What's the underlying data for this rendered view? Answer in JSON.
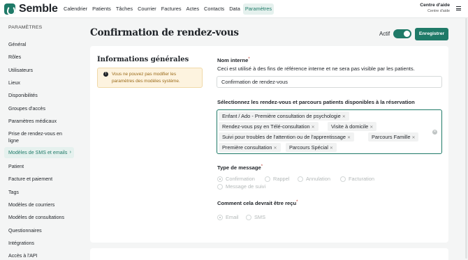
{
  "app": {
    "name": "Semble"
  },
  "nav": {
    "items": [
      "Calendrier",
      "Patients",
      "Tâches",
      "Courrier",
      "Factures",
      "Actes",
      "Contacts",
      "Data",
      "Paramètres"
    ],
    "active_index": 8
  },
  "account": {
    "name": "Centre d'aide",
    "subtitle": "Centre d'aide"
  },
  "sidebar": {
    "title": "PARAMÈTRES",
    "items": [
      "Général",
      "Rôles",
      "Utilisateurs",
      "Lieux",
      "Disponibilités",
      "Groupes d'accès",
      "Paramètres médicaux",
      "Prise de rendez-vous en ligne",
      "Modèles de SMS et emails",
      "Patient",
      "Facture et paiement",
      "Tags",
      "Modèles de courriers",
      "Modèles de consultations",
      "Questionnaires",
      "Intégrations",
      "Accès à l'API"
    ],
    "active_index": 8
  },
  "header": {
    "title": "Confirmation de rendez-vous",
    "active_label": "Actif",
    "active": true,
    "save_label": "Enregistrer"
  },
  "general": {
    "title": "Informations générales",
    "warning": "Vous ne pouvez pas modifier les paramètres des modèles système.",
    "internal_name_label": "Nom interne",
    "internal_name_help": "Ceci est utilisé à des fins de référence interne et ne sera pas visible par les patients.",
    "internal_name_value": "Confirmation de rendez-vous",
    "appointments_label": "Sélectionnez les rendez-vous et parcours patients disponibles à la réservation",
    "chips": [
      "Enfant / Ado - Première consultation de psychologie",
      "Rendez-vous psy en Télé-consultation",
      "Visite à domicile",
      "Suivi pour troubles de l'attention ou de l'apprentissage",
      "Parcours Famille",
      "Première consultation",
      "Parcours Spécial"
    ],
    "message_type_label": "Type de message",
    "message_types": [
      "Confirmation",
      "Rappel",
      "Annulation",
      "Facturation",
      "Message de suivi"
    ],
    "message_type_selected": "Confirmation",
    "channel_label": "Comment cela devrait être reçu",
    "channels": [
      "Email",
      "SMS"
    ],
    "channel_selected": "Email"
  }
}
